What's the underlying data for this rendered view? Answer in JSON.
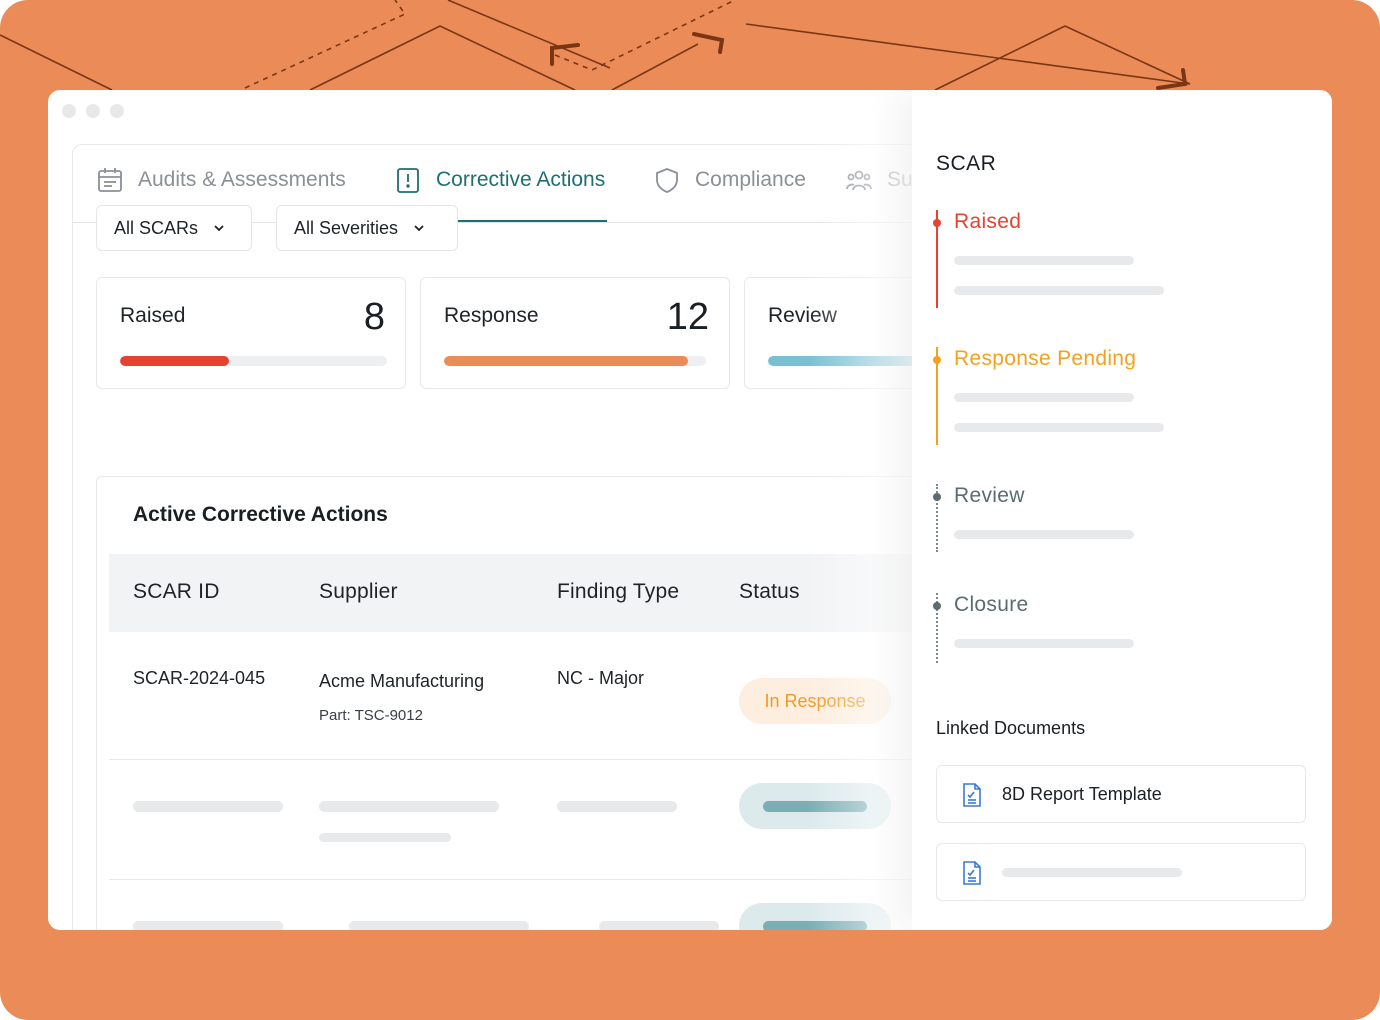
{
  "tabs": [
    {
      "label": "Audits & Assessments",
      "icon": "calendar-icon"
    },
    {
      "label": "Corrective Actions",
      "icon": "alert-doc-icon",
      "active": true
    },
    {
      "label": "Compliance",
      "icon": "shield-icon"
    },
    {
      "label": "Su",
      "icon": "users-icon"
    }
  ],
  "filters": {
    "scars": "All SCARs",
    "severities": "All Severities"
  },
  "stats": [
    {
      "label": "Raised",
      "value": "8",
      "progress": 0.41,
      "color": "#E4432F"
    },
    {
      "label": "Response",
      "value": "12",
      "progress": 0.93,
      "color": "#EB8C58"
    },
    {
      "label": "Review",
      "value": "",
      "progress": 0.6,
      "color": "#79C0D4"
    }
  ],
  "table": {
    "title": "Active Corrective Actions",
    "columns": [
      "SCAR ID",
      "Supplier",
      "Finding Type",
      "Status"
    ],
    "rows": [
      {
        "id": "SCAR-2024-045",
        "supplier": "Acme Manufacturing",
        "part": "Part: TSC-9012",
        "finding": "NC - Major",
        "status": "In Response"
      }
    ]
  },
  "side_panel": {
    "title": "SCAR",
    "steps": [
      {
        "name": "Raised",
        "color": "#E4432F",
        "state": "done"
      },
      {
        "name": "Response Pending",
        "color": "#F5A11E",
        "state": "active"
      },
      {
        "name": "Review",
        "color": "#5B6B70",
        "state": "pending"
      },
      {
        "name": "Closure",
        "color": "#5B6B70",
        "state": "pending"
      }
    ],
    "linked_title": "Linked Documents",
    "documents": [
      {
        "name": "8D Report Template",
        "icon": "document-icon"
      },
      {
        "name": "",
        "icon": "document-icon"
      }
    ]
  },
  "colors": {
    "accent": "#1F6E73",
    "background": "#EB8C58",
    "status_pill_bg": "#FDEEDF",
    "status_pill_text": "#F29A20"
  }
}
